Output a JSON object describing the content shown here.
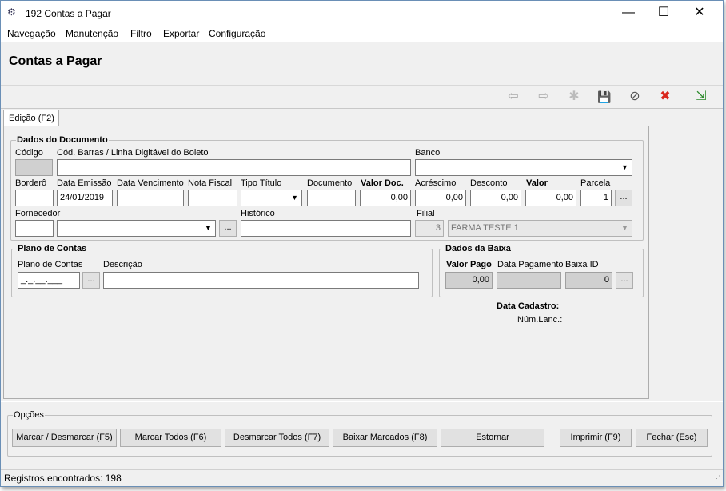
{
  "window": {
    "title": "192 Contas a Pagar",
    "minimize": "—",
    "maximize": "☐",
    "close": "✕"
  },
  "menu": [
    "Navegação",
    "Manutenção",
    "Filtro",
    "Exportar",
    "Configuração"
  ],
  "header": {
    "title": "Contas a Pagar"
  },
  "toolbar": {
    "back": "⇦",
    "forward": "⇨",
    "new": "✱",
    "save": "💾",
    "cancel": "⊘",
    "delete": "✖",
    "exit": "⇲"
  },
  "tab": "Edição (F2)",
  "dados_documento": {
    "title": "Dados do Documento",
    "codigo_label": "Código",
    "codigo_value": "",
    "cod_barras_label": "Cód. Barras / Linha Digitável do Boleto",
    "cod_barras_value": "",
    "banco_label": "Banco",
    "banco_value": "",
    "bordero_label": "Borderô",
    "bordero_value": "",
    "data_emissao_label": "Data Emissão",
    "data_emissao_value": "24/01/2019",
    "data_vencimento_label": "Data Vencimento",
    "data_vencimento_value": "",
    "nota_fiscal_label": "Nota Fiscal",
    "nota_fiscal_value": "",
    "tipo_titulo_label": "Tipo Título",
    "tipo_titulo_value": "",
    "documento_label": "Documento",
    "documento_value": "",
    "valor_doc_label": "Valor Doc.",
    "valor_doc_value": "0,00",
    "acrescimo_label": "Acréscimo",
    "acrescimo_value": "0,00",
    "desconto_label": "Desconto",
    "desconto_value": "0,00",
    "valor_label": "Valor",
    "valor_value": "0,00",
    "parcela_label": "Parcela",
    "parcela_value": "1",
    "fornecedor_label": "Fornecedor",
    "fornecedor_code": "",
    "fornecedor_value": "",
    "historico_label": "Histórico",
    "historico_value": "",
    "filial_label": "Filial",
    "filial_code": "3",
    "filial_value": "FARMA TESTE 1"
  },
  "plano_contas": {
    "title": "Plano de Contas",
    "plano_label": "Plano de Contas",
    "plano_value": "_._.__.___",
    "descricao_label": "Descrição",
    "descricao_value": ""
  },
  "dados_baixa": {
    "title": "Dados da Baixa",
    "valor_pago_label": "Valor Pago",
    "valor_pago_value": "0,00",
    "data_pagamento_label": "Data Pagamento",
    "data_pagamento_value": "",
    "baixa_id_label": "Baixa ID",
    "baixa_id_value": "0"
  },
  "cadastro": {
    "data_cadastro_label": "Data Cadastro:",
    "num_lanc_label": "Núm.Lanc.:"
  },
  "ellipsis": "...",
  "opcoes": {
    "title": "Opções",
    "marcar": "Marcar / Desmarcar (F5)",
    "marcar_todos": "Marcar Todos (F6)",
    "desmarcar_todos": "Desmarcar Todos (F7)",
    "baixar": "Baixar Marcados (F8)",
    "estornar": "Estornar",
    "imprimir": "Imprimir (F9)",
    "fechar": "Fechar (Esc)"
  },
  "status": "Registros encontrados: 198"
}
